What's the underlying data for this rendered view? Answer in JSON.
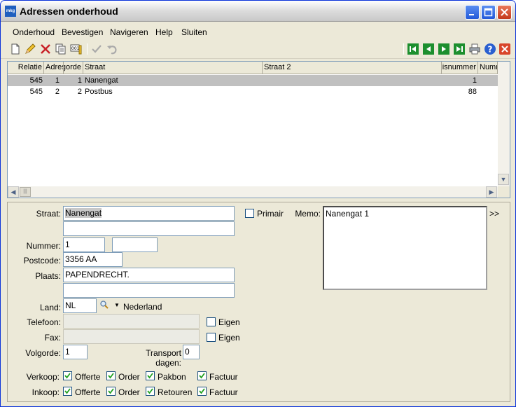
{
  "window": {
    "app_icon_text": "mkg",
    "title": "Adressen onderhoud"
  },
  "menu": {
    "items": [
      "Onderhoud",
      "Bevestigen",
      "Navigeren",
      "Help",
      "Sluiten"
    ]
  },
  "grid": {
    "columns": [
      "Relatie",
      "Adres",
      "Volgorde",
      "Straat",
      "Straat 2",
      "Huisnummer",
      "Numm"
    ],
    "rows": [
      {
        "relatie": "545",
        "adres": "1",
        "volgorde": "1",
        "straat": "Nanengat",
        "straat2": "",
        "huisnummer": "1",
        "numm": ""
      },
      {
        "relatie": "545",
        "adres": "2",
        "volgorde": "2",
        "straat": "Postbus",
        "straat2": "",
        "huisnummer": "88",
        "numm": ""
      }
    ],
    "selected_row": 0
  },
  "form": {
    "straat_label": "Straat:",
    "straat_value": "Nanengat",
    "straat2_value": "",
    "primair_label": "Primair",
    "memo_label": "Memo:",
    "memo_value": "Nanengat 1",
    "expand_label": ">>",
    "nummer_label": "Nummer:",
    "nummer_value": "1",
    "nummer_toevoeging_value": "",
    "postcode_label": "Postcode:",
    "postcode_value": "3356 AA",
    "plaats_label": "Plaats:",
    "plaats_value": "PAPENDRECHT.",
    "plaats2_value": "",
    "land_label": "Land:",
    "land_value": "NL",
    "land_name": "Nederland",
    "telefoon_label": "Telefoon:",
    "telefoon_value": "",
    "eigen1_label": "Eigen",
    "fax_label": "Fax:",
    "fax_value": "",
    "eigen2_label": "Eigen",
    "volgorde_label": "Volgorde:",
    "volgorde_value": "1",
    "transport_label": "Transport dagen:",
    "transport_value": "0",
    "verkoop_label": "Verkoop:",
    "verkoop_options": [
      "Offerte",
      "Order",
      "Pakbon",
      "Factuur"
    ],
    "inkoop_label": "Inkoop:",
    "inkoop_options": [
      "Offerte",
      "Order",
      "Retouren",
      "Factuur"
    ]
  }
}
